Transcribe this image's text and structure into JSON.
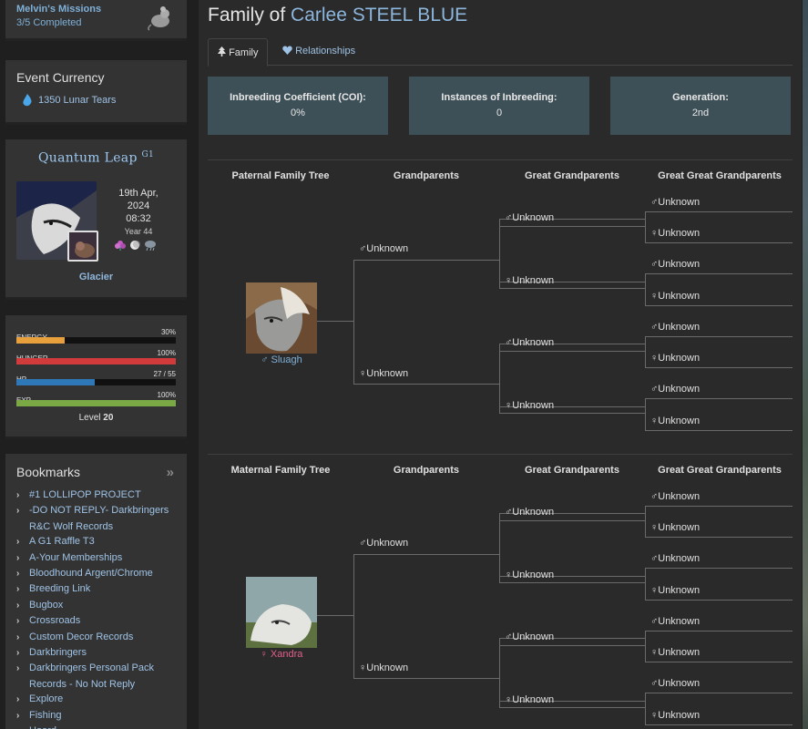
{
  "sidebar": {
    "missions": {
      "title": "Melvin's Missions",
      "progress": "3/5 Completed"
    },
    "currency": {
      "title": "Event Currency",
      "value": "1350 Lunar Tears"
    },
    "profile": {
      "name": "Quantum Leap",
      "gen": "G1",
      "date": "19th Apr, 2024",
      "time": "08:32",
      "year": "Year 44",
      "mood": "Glacier"
    },
    "stats": [
      {
        "label": "ENERGY",
        "value": "30%",
        "fraction": 0.3,
        "color": "#e8a03c"
      },
      {
        "label": "HUNGER",
        "value": "100%",
        "fraction": 1.0,
        "color": "#d23b3b"
      },
      {
        "label": "HP",
        "value": "27 / 55",
        "fraction": 0.49,
        "color": "#2e78b8"
      },
      {
        "label": "EXP",
        "value": "100%",
        "fraction": 1.0,
        "color": "#7aa845"
      }
    ],
    "level_label": "Level",
    "level": "20",
    "bookmarks_title": "Bookmarks",
    "bookmarks": [
      "#1 LOLLIPOP PROJECT",
      "-DO NOT REPLY- Darkbringers R&C Wolf Records",
      "A G1 Raffle T3",
      "A-Your Memberships",
      "Bloodhound Argent/Chrome",
      "Breeding Link",
      "Bugbox",
      "Crossroads",
      "Custom Decor Records",
      "Darkbringers",
      "Darkbringers Personal Pack Records - No Not Reply",
      "Explore",
      "Fishing",
      "Hoard"
    ]
  },
  "main": {
    "title_prefix": "Family of",
    "pet_name": "Carlee STEEL BLUE",
    "tabs": [
      "Family",
      "Relationships"
    ],
    "cards": [
      {
        "label": "Inbreeding Coefficient (COI):",
        "value": "0%"
      },
      {
        "label": "Instances of Inbreeding:",
        "value": "0"
      },
      {
        "label": "Generation:",
        "value": "2nd"
      }
    ],
    "paternal": {
      "headers": [
        "Paternal Family Tree",
        "Grandparents",
        "Great Grandparents",
        "Great Great Grandparents"
      ],
      "parent": {
        "symbol": "♂",
        "name": "Sluagh"
      },
      "unknown": "Unknown"
    },
    "maternal": {
      "headers": [
        "Maternal Family Tree",
        "Grandparents",
        "Great Grandparents",
        "Great Great Grandparents"
      ],
      "parent": {
        "symbol": "♀",
        "name": "Xandra"
      },
      "unknown": "Unknown"
    }
  }
}
